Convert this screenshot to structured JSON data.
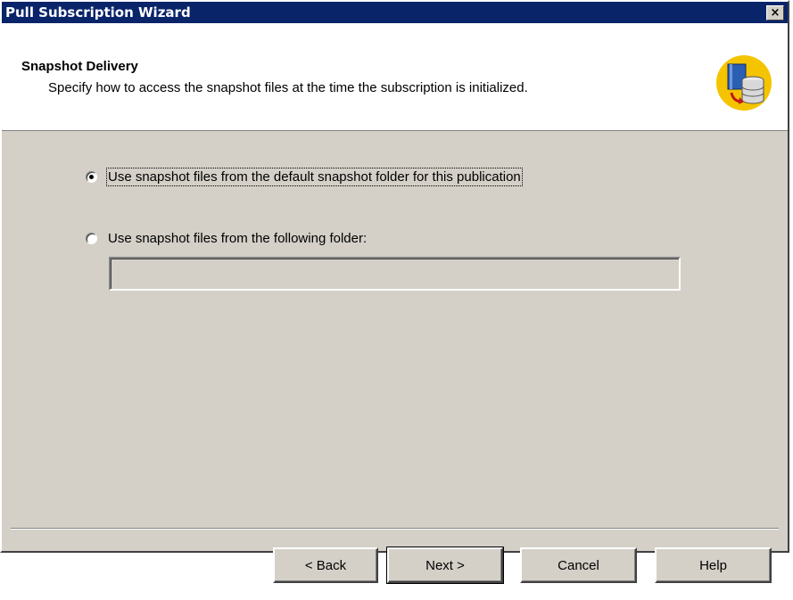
{
  "window": {
    "title": "Pull Subscription Wizard",
    "close_label": "×"
  },
  "header": {
    "title": "Snapshot Delivery",
    "subtitle": "Specify how to access the snapshot files at the time the subscription is initialized.",
    "icon": "snapshot-database-icon"
  },
  "options": [
    {
      "label": "Use snapshot files from the default snapshot folder for this publication",
      "checked": true
    },
    {
      "label": "Use snapshot files from the following folder:",
      "checked": false
    }
  ],
  "folder_input": {
    "value": "",
    "placeholder": ""
  },
  "buttons": {
    "back": "< Back",
    "next": "Next >",
    "cancel": "Cancel",
    "help": "Help"
  },
  "colors": {
    "titlebar": "#0a246a",
    "dialog_bg": "#d4d0c8",
    "header_bg": "#ffffff",
    "icon_accent": "#f5c400"
  }
}
